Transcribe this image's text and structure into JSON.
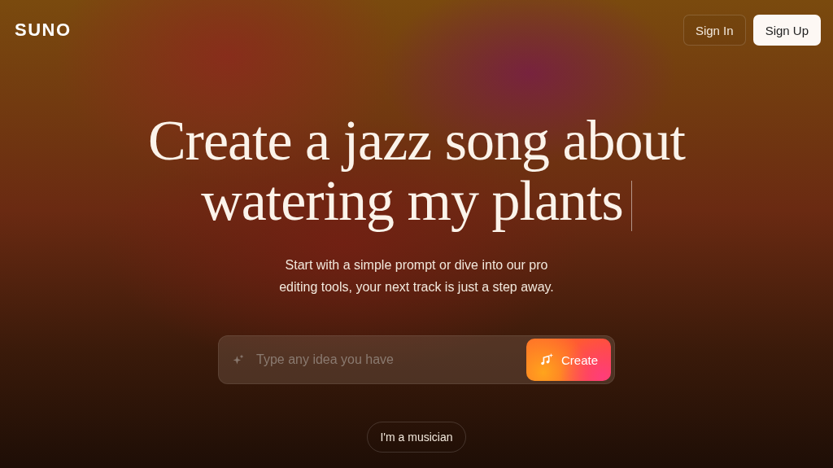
{
  "header": {
    "logo": "SUNO",
    "sign_in": "Sign In",
    "sign_up": "Sign Up"
  },
  "hero": {
    "headline_lines": [
      "Create a jazz song about",
      "watering my plants"
    ],
    "caret": true,
    "subtitle_lines": [
      "Start with a simple prompt or dive into our pro",
      "editing tools, your next track is just a step away."
    ]
  },
  "prompt": {
    "placeholder": "Type any idea you have",
    "button": "Create"
  },
  "musician_button": "I'm a musician"
}
